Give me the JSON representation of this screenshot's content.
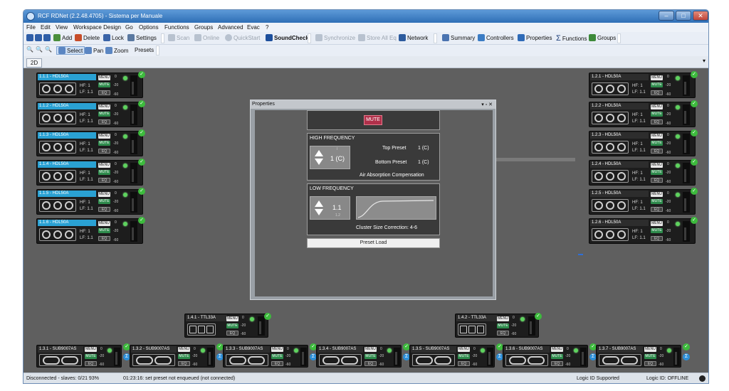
{
  "window": {
    "title": "RCF RDNet (2.2.48.4705) - Sistema per Manuale"
  },
  "menu": [
    "File",
    "Edit",
    "View",
    "Workspace Design",
    "Go",
    "Options",
    "Functions",
    "Groups",
    "Advanced",
    "Evac",
    "?"
  ],
  "toolbar": {
    "add": "Add",
    "delete": "Delete",
    "lock": "Lock",
    "settings": "Settings",
    "scan": "Scan",
    "online": "Online",
    "quickstart": "QuickStart",
    "soundcheck": "SoundCheck",
    "synchronize": "Synchronize",
    "store_all_eq": "Store All Eq",
    "network": "Network",
    "summary": "Summary",
    "controllers": "Controllers",
    "properties": "Properties",
    "functions": "Functions",
    "groups": "Groups"
  },
  "toolbar2": {
    "select": "Select",
    "pan": "Pan",
    "zoom": "Zoom",
    "presets": "Presets"
  },
  "tab": "2D",
  "device_common": {
    "menu": "MENU",
    "mute": "MUTE",
    "eq": "EQ",
    "hf": "HF: 1",
    "lf": "LF: 1.1",
    "scale0": "0",
    "scale20": "-20",
    "scale60": "-60",
    "check": "✓",
    "sigma": "Σ"
  },
  "left_devices": [
    "1.1.1 - HDL50A",
    "1.1.2 - HDL50A",
    "1.1.3 - HDL50A",
    "1.1.4 - HDL50A",
    "1.1.5 - HDL50A",
    "1.1.6 - HDL50A"
  ],
  "right_devices": [
    "1.2.1 - HDL50A",
    "1.2.2 - HDL50A",
    "1.2.3 - HDL50A",
    "1.2.4 - HDL50A",
    "1.2.5 - HDL50A",
    "1.2.6 - HDL50A"
  ],
  "mid_devices": [
    "1.4.1 - TTL33A",
    "1.4.2 - TTL33A"
  ],
  "sub_devices": [
    "1.3.1 - SUB9007AS",
    "1.3.2 - SUB9007AS",
    "1.3.3 - SUB9007AS",
    "1.3.4 - SUB9007AS",
    "1.3.5 - SUB9007AS",
    "1.3.6 - SUB9007AS",
    "1.3.7 - SUB9007AS"
  ],
  "properties": {
    "title": "Properties",
    "controls": "▾ ▫ ✕",
    "mute": "MUTE",
    "hf_title": "HIGH FREQUENCY",
    "hf_value": "1 (C)",
    "hf_small": "I",
    "top_preset_label": "Top Preset",
    "top_preset_value": "1 (C)",
    "bottom_preset_label": "Bottom Preset",
    "bottom_preset_value": "1 (C)",
    "air": "Air Absorption Compensation",
    "lf_title": "LOW FREQUENCY",
    "lf_value": "1.1",
    "lf_small": "1.2",
    "cluster": "Cluster Size Correction:  4-6",
    "preset_load": "Preset Load"
  },
  "status": {
    "left": "Disconnected - slaves: 0/21  93%",
    "msg": "01:23:16: set preset not enqueued (not connected)",
    "logic": "Logic ID Supported",
    "logic_id": "Logic ID: OFFLINE"
  },
  "colors": {
    "selected_label": "#2aa1d3",
    "mute_green": "#2e8b4c",
    "led_green": "#5dd35d",
    "mute_button": "#b0304a"
  }
}
